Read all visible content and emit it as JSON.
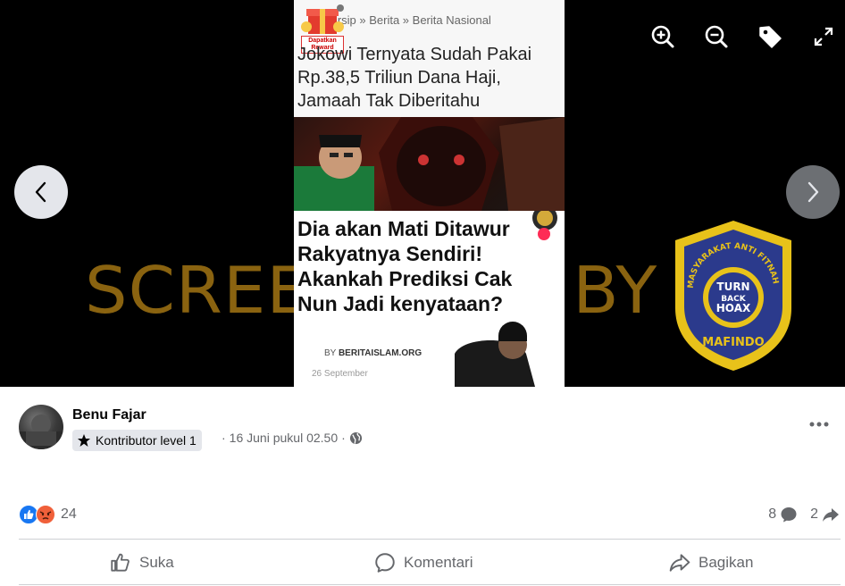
{
  "viewer": {
    "watermark_text": "SCREENSHOT BY",
    "logo": {
      "ring_text_top": "MASYARAKAT ANTI FITNAH INDONESIA",
      "center_lines": [
        "TURN",
        "BACK",
        "HOAX"
      ],
      "bottom_text": "MAFINDO"
    },
    "toolbar": [
      "zoom-in-icon",
      "zoom-out-icon",
      "tag-icon",
      "fullscreen-icon"
    ],
    "screenshot": {
      "breadcrumb": "...rsip » Berita » Berita Nasional",
      "reward_label": "Dapatkan Reward",
      "headline1": "Jokowi Ternyata Sudah Pakai Rp.38,5 Triliun Dana Haji, Jamaah Tak Diberitahu",
      "headline2": "Dia akan Mati Ditawur Rakyatnya Sendiri! Akankah Prediksi Cak Nun Jadi kenyataan?",
      "by_prefix": "BY",
      "by_source": "BERITAISLAM.ORG",
      "date": "26 September"
    }
  },
  "post": {
    "author": "Benu Fajar",
    "badge_label": "Kontributor level 1",
    "timestamp": "16 Juni pukul 02.50",
    "separator": "·",
    "reaction_count": "24",
    "comment_count": "8",
    "share_count": "2",
    "actions": {
      "like": "Suka",
      "comment": "Komentari",
      "share": "Bagikan"
    }
  },
  "colors": {
    "watermark": "#8a6310",
    "logo_yellow": "#e8c21a",
    "logo_blue": "#2b3a8c",
    "like_blue": "#1877f2",
    "angry_orange": "#f0603a",
    "secondary_text": "#65676b"
  }
}
